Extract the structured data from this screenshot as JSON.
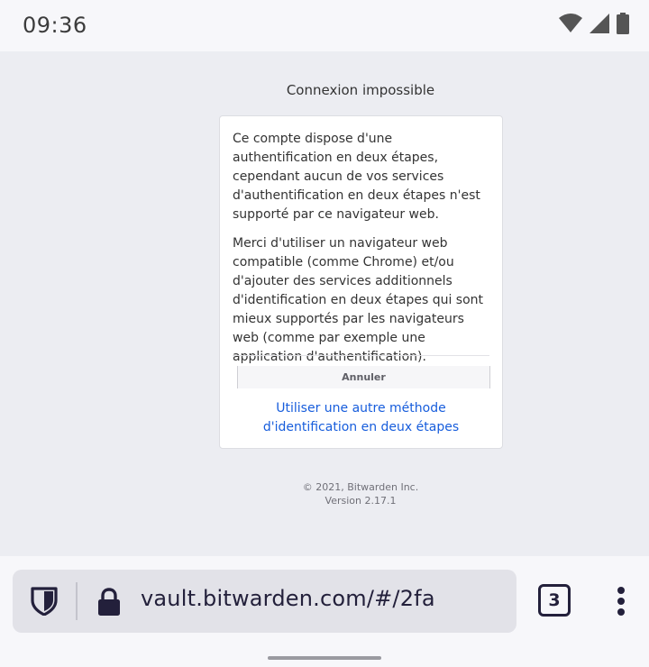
{
  "status_bar": {
    "time": "09:36",
    "icons": [
      "wifi-icon",
      "signal-icon",
      "battery-icon"
    ]
  },
  "page": {
    "title": "Connexion impossible",
    "message_1": "Ce compte dispose d'une authentification en deux étapes, cependant aucun de vos services d'authentification en deux étapes n'est supporté par ce navigateur web.",
    "message_2": "Merci d'utiliser un navigateur web compatible (comme Chrome) et/ou d'ajouter des services additionnels d'identification en deux étapes qui sont mieux supportés par les navigateurs web (comme par exemple une application d'authentification).",
    "cancel_label": "Annuler",
    "alt_method_link": "Utiliser une autre méthode d'identification en deux étapes",
    "copyright": "© 2021, Bitwarden Inc.",
    "version": "Version 2.17.1"
  },
  "browser": {
    "url": "vault.bitwarden.com/#/2fa",
    "tab_count": "3",
    "icons": [
      "shield-icon",
      "lock-icon",
      "more-vert-icon"
    ]
  },
  "colors": {
    "link": "#175ddc",
    "page_bg": "#ecedf2",
    "toolbar_text": "#23203b"
  }
}
